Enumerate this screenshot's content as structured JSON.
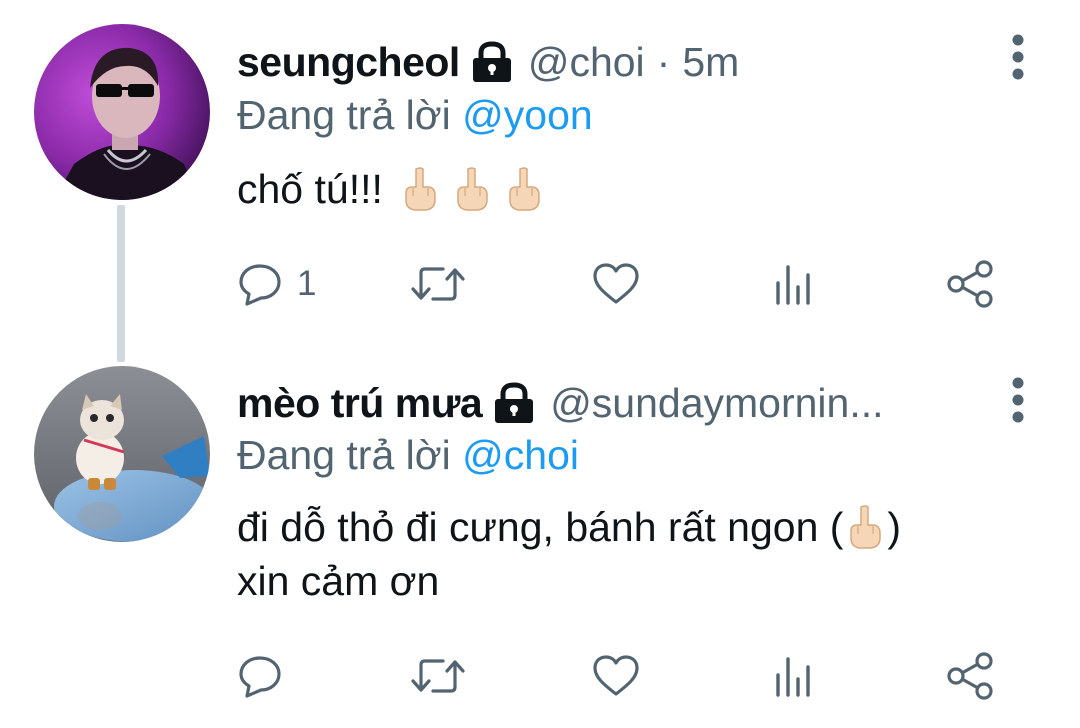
{
  "tweets": [
    {
      "display_name": "seungcheol",
      "handle": "@choi",
      "separator": "·",
      "time": "5m",
      "reply_prefix": "Đang trả lời",
      "reply_to": "@yoon",
      "body_text": "chố tú!!!",
      "body_line2": "",
      "reply_count": "1",
      "avatar_subject": "person in sunglasses with purple background",
      "protected": true
    },
    {
      "display_name": "mèo trú mưa",
      "handle": "@sundaymornin...",
      "reply_prefix": "Đang trả lời",
      "reply_to": "@choi",
      "body_text": "đi dỗ thỏ đi cưng, bánh rất ngon (",
      "body_text_end": ")",
      "body_line2": "xin cảm ơn",
      "reply_count": "",
      "avatar_subject": "kitten toy standing in rain puddle",
      "protected": true
    }
  ],
  "icons": {
    "lock": "lock-icon",
    "more": "more-vertical-icon",
    "reply": "reply-icon",
    "retweet": "retweet-icon",
    "like": "heart-icon",
    "analytics": "analytics-icon",
    "share": "share-icon",
    "emoji": "middle-finger-emoji"
  },
  "colors": {
    "text_primary": "#0f1419",
    "text_secondary": "#536471",
    "link": "#1d9bf0",
    "thread_line": "#cfd9de"
  }
}
